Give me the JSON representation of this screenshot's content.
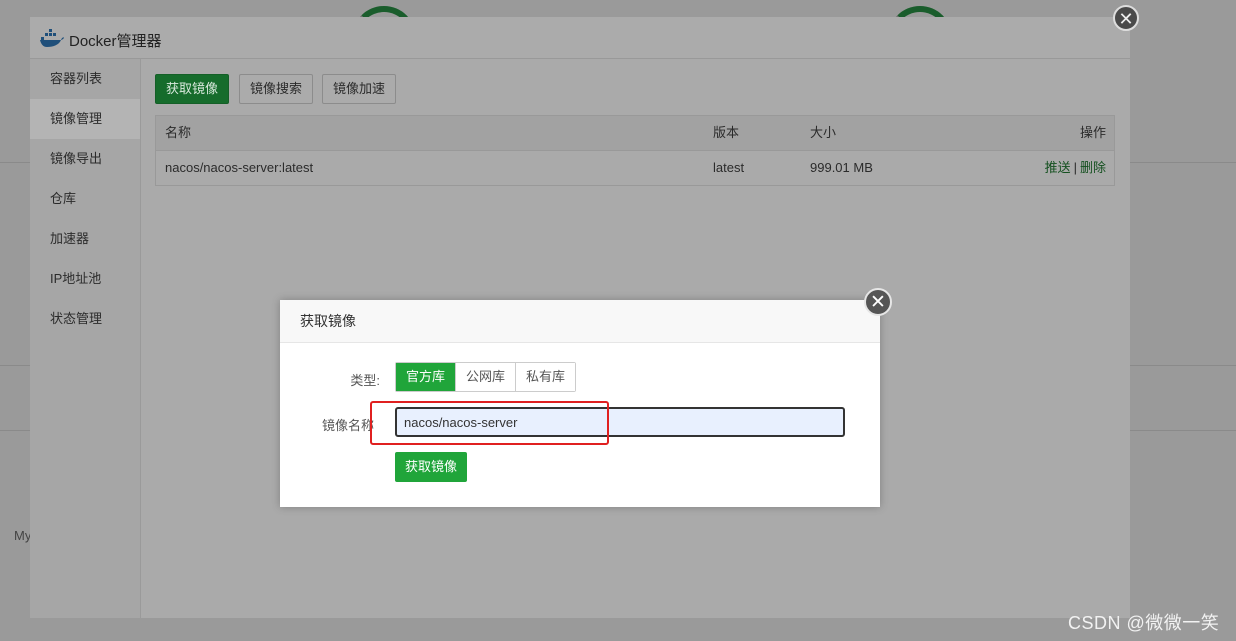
{
  "window": {
    "title": "Docker管理器",
    "close_glyph": "✕"
  },
  "sidebar": {
    "items": [
      {
        "label": "容器列表"
      },
      {
        "label": "镜像管理"
      },
      {
        "label": "镜像导出"
      },
      {
        "label": "仓库"
      },
      {
        "label": "加速器"
      },
      {
        "label": "IP地址池"
      },
      {
        "label": "状态管理"
      }
    ],
    "active_index": 1
  },
  "toolbar": {
    "get_image": "获取镜像",
    "search_image": "镜像搜索",
    "accelerate_image": "镜像加速"
  },
  "table": {
    "headers": {
      "name": "名称",
      "version": "版本",
      "size": "大小",
      "actions": "操作"
    },
    "rows": [
      {
        "name": "nacos/nacos-server:latest",
        "version": "latest",
        "size": "999.01 MB",
        "push": "推送",
        "separator": "|",
        "delete": "删除"
      }
    ]
  },
  "modal": {
    "title": "获取镜像",
    "close_glyph": "✕",
    "type_label": "类型:",
    "type_options": [
      "官方库",
      "公网库",
      "私有库"
    ],
    "type_selected": "官方库",
    "name_label": "镜像名称",
    "name_value": "nacos/nacos-server",
    "submit_label": "获取镜像"
  },
  "background": {
    "partial_text": "My"
  },
  "watermark": "CSDN @微微一笑",
  "colors": {
    "accent_green": "#20a53a",
    "highlight_red": "#e02020",
    "input_bg": "#e8f0fe"
  },
  "icons": {
    "logo": "docker-whale-icon",
    "close": "close-icon"
  }
}
